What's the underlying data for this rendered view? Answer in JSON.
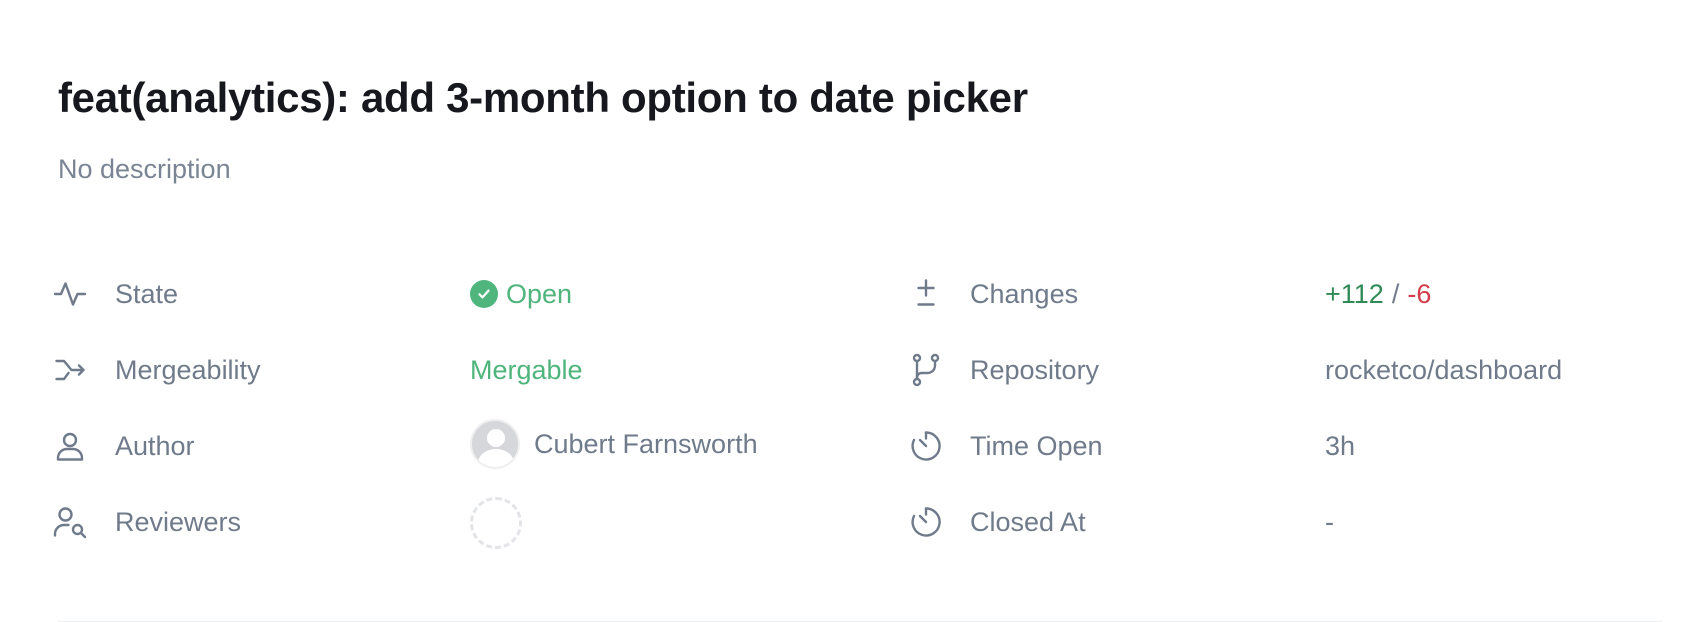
{
  "pr": {
    "title": "feat(analytics): add 3-month option to date picker",
    "description": "No description"
  },
  "left_fields": {
    "state": {
      "label": "State",
      "value": "Open"
    },
    "mergeability": {
      "label": "Mergeability",
      "value": "Mergable"
    },
    "author": {
      "label": "Author",
      "value": "Cubert Farnsworth"
    },
    "reviewers": {
      "label": "Reviewers"
    }
  },
  "right_fields": {
    "changes": {
      "label": "Changes",
      "additions": "+112",
      "separator": "/",
      "deletions": "-6"
    },
    "repository": {
      "label": "Repository",
      "value": "rocketco/dashboard"
    },
    "time_open": {
      "label": "Time Open",
      "value": "3h"
    },
    "closed_at": {
      "label": "Closed At",
      "value": "-"
    }
  },
  "icons": {
    "state": "activity-icon",
    "mergeability": "merge-arrow-icon",
    "author": "user-icon",
    "reviewers": "user-search-icon",
    "changes": "plus-minus-icon",
    "repository": "git-branch-icon",
    "time_open": "timer-icon",
    "closed_at": "timer-icon"
  },
  "colors": {
    "open_green": "#4fb57c",
    "additions_green": "#2f8a55",
    "deletions_red": "#d33a4b",
    "muted": "#6f7a8b"
  }
}
